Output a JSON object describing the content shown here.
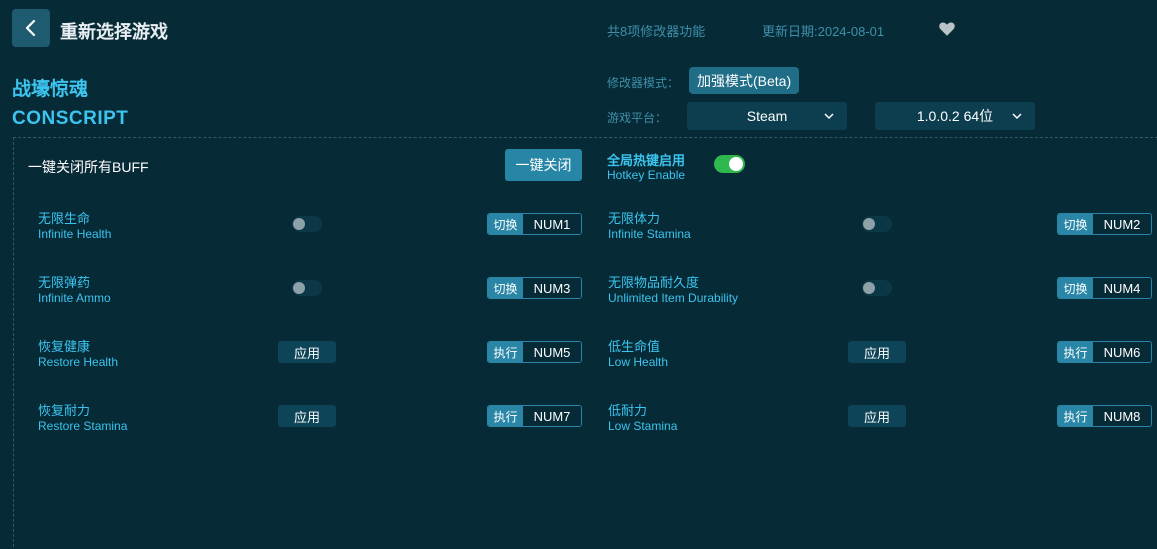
{
  "header": {
    "title": "重新选择游戏",
    "feature_count": "共8项修改器功能",
    "update_date": "更新日期:2024-08-01"
  },
  "game": {
    "title_cn": "战壕惊魂",
    "title_en": "CONSCRIPT"
  },
  "mode": {
    "label": "修改器模式：",
    "value": "加强模式(Beta)"
  },
  "platform": {
    "label": "游戏平台：",
    "selected": "Steam",
    "version": "1.0.0.2 64位"
  },
  "panel": {
    "buff_label": "一键关闭所有BUFF",
    "close_all_label": "一键关闭",
    "hotkey_cn": "全局热键启用",
    "hotkey_en": "Hotkey Enable",
    "hotkey_enabled": true
  },
  "cheats": [
    {
      "cn": "无限生命",
      "en": "Infinite Health",
      "control": "toggle",
      "action": "切换",
      "key": "NUM1"
    },
    {
      "cn": "无限体力",
      "en": "Infinite Stamina",
      "control": "toggle",
      "action": "切换",
      "key": "NUM2"
    },
    {
      "cn": "无限弹药",
      "en": "Infinite Ammo",
      "control": "toggle",
      "action": "切换",
      "key": "NUM3"
    },
    {
      "cn": "无限物品耐久度",
      "en": "Unlimited Item Durability",
      "control": "toggle",
      "action": "切换",
      "key": "NUM4"
    },
    {
      "cn": "恢复健康",
      "en": "Restore Health",
      "control": "apply",
      "apply_label": "应用",
      "action": "执行",
      "key": "NUM5"
    },
    {
      "cn": "低生命值",
      "en": "Low Health",
      "control": "apply",
      "apply_label": "应用",
      "action": "执行",
      "key": "NUM6"
    },
    {
      "cn": "恢复耐力",
      "en": "Restore Stamina",
      "control": "apply",
      "apply_label": "应用",
      "action": "执行",
      "key": "NUM7"
    },
    {
      "cn": "低耐力",
      "en": "Low Stamina",
      "control": "apply",
      "apply_label": "应用",
      "action": "执行",
      "key": "NUM8"
    }
  ],
  "colors": {
    "background": "#062a36",
    "accent": "#3cc4ee",
    "button": "#2786a6",
    "toggle_on": "#2fb84e"
  },
  "icons": {
    "back": "chevron-left-icon",
    "favorite": "heart-icon",
    "dropdown": "chevron-down-icon"
  }
}
